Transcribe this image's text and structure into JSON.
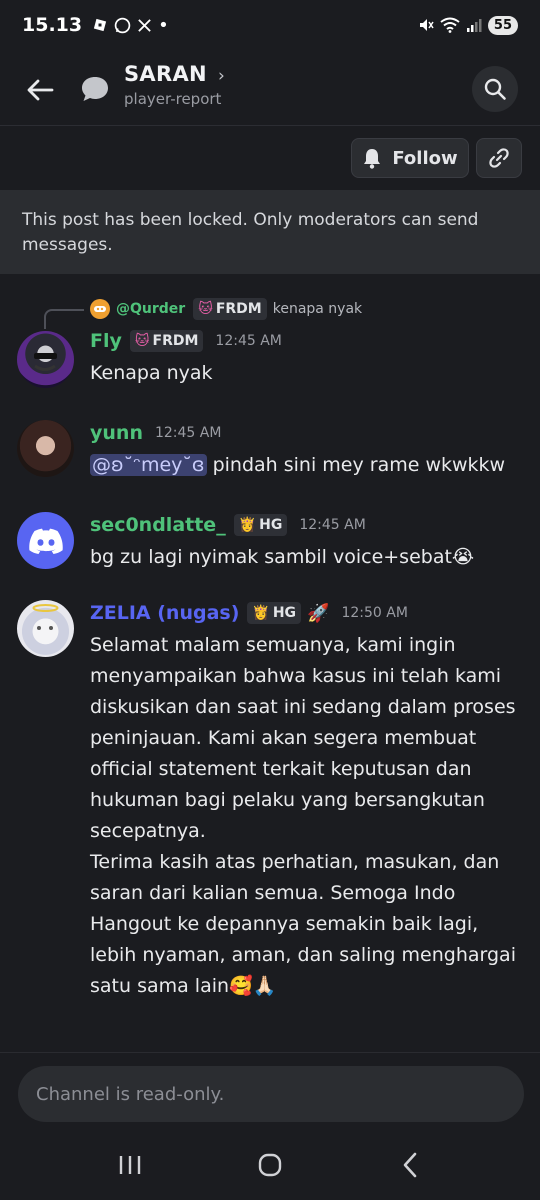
{
  "status_bar": {
    "time": "15.13",
    "battery": "55"
  },
  "header": {
    "title": "SARAN",
    "subtitle": "player-report"
  },
  "actions": {
    "follow_label": "Follow"
  },
  "locked_notice": "This post has been locked. Only moderators can send messages.",
  "reply": {
    "author": "@Qurder",
    "tag": "FRDM",
    "text": "kenapa nyak"
  },
  "messages": [
    {
      "author": "Fly",
      "author_color": "#4fc27a",
      "tag": "FRDM",
      "time": "12:45 AM",
      "text": "Kenapa nyak"
    },
    {
      "author": "yunn",
      "author_color": "#4fc27a",
      "time": "12:45 AM",
      "mention": "@ʚ˘ᵔmey˘ɞ",
      "text": " pindah sini mey rame wkwkkw"
    },
    {
      "author": "sec0ndlatte_",
      "author_color": "#4fc27a",
      "tag": "HG",
      "time": "12:45 AM",
      "text": "bg zu lagi nyimak sambil voice+sebat😭"
    },
    {
      "author": "ZELIA (nugas)",
      "author_color": "#5865f2",
      "tag": "HG",
      "extra_badge": "🚀",
      "time": "12:50 AM",
      "text": "Selamat malam semuanya, kami ingin menyampaikan bahwa kasus ini telah kami diskusikan dan saat ini sedang dalam proses peninjauan. Kami akan segera membuat official statement terkait keputusan dan hukuman bagi pelaku yang bersangkutan secepatnya.\nTerima kasih atas perhatian, masukan, dan saran dari kalian semua. Semoga Indo Hangout ke depannya semakin baik lagi, lebih nyaman, aman, dan saling menghargai satu sama lain🥰🙏🏻"
    }
  ],
  "input": {
    "placeholder": "Channel is read-only."
  },
  "colors": {
    "background": "#1b1c20",
    "panel": "#2b2d31",
    "green_name": "#4fc27a",
    "blurple": "#5865f2"
  }
}
